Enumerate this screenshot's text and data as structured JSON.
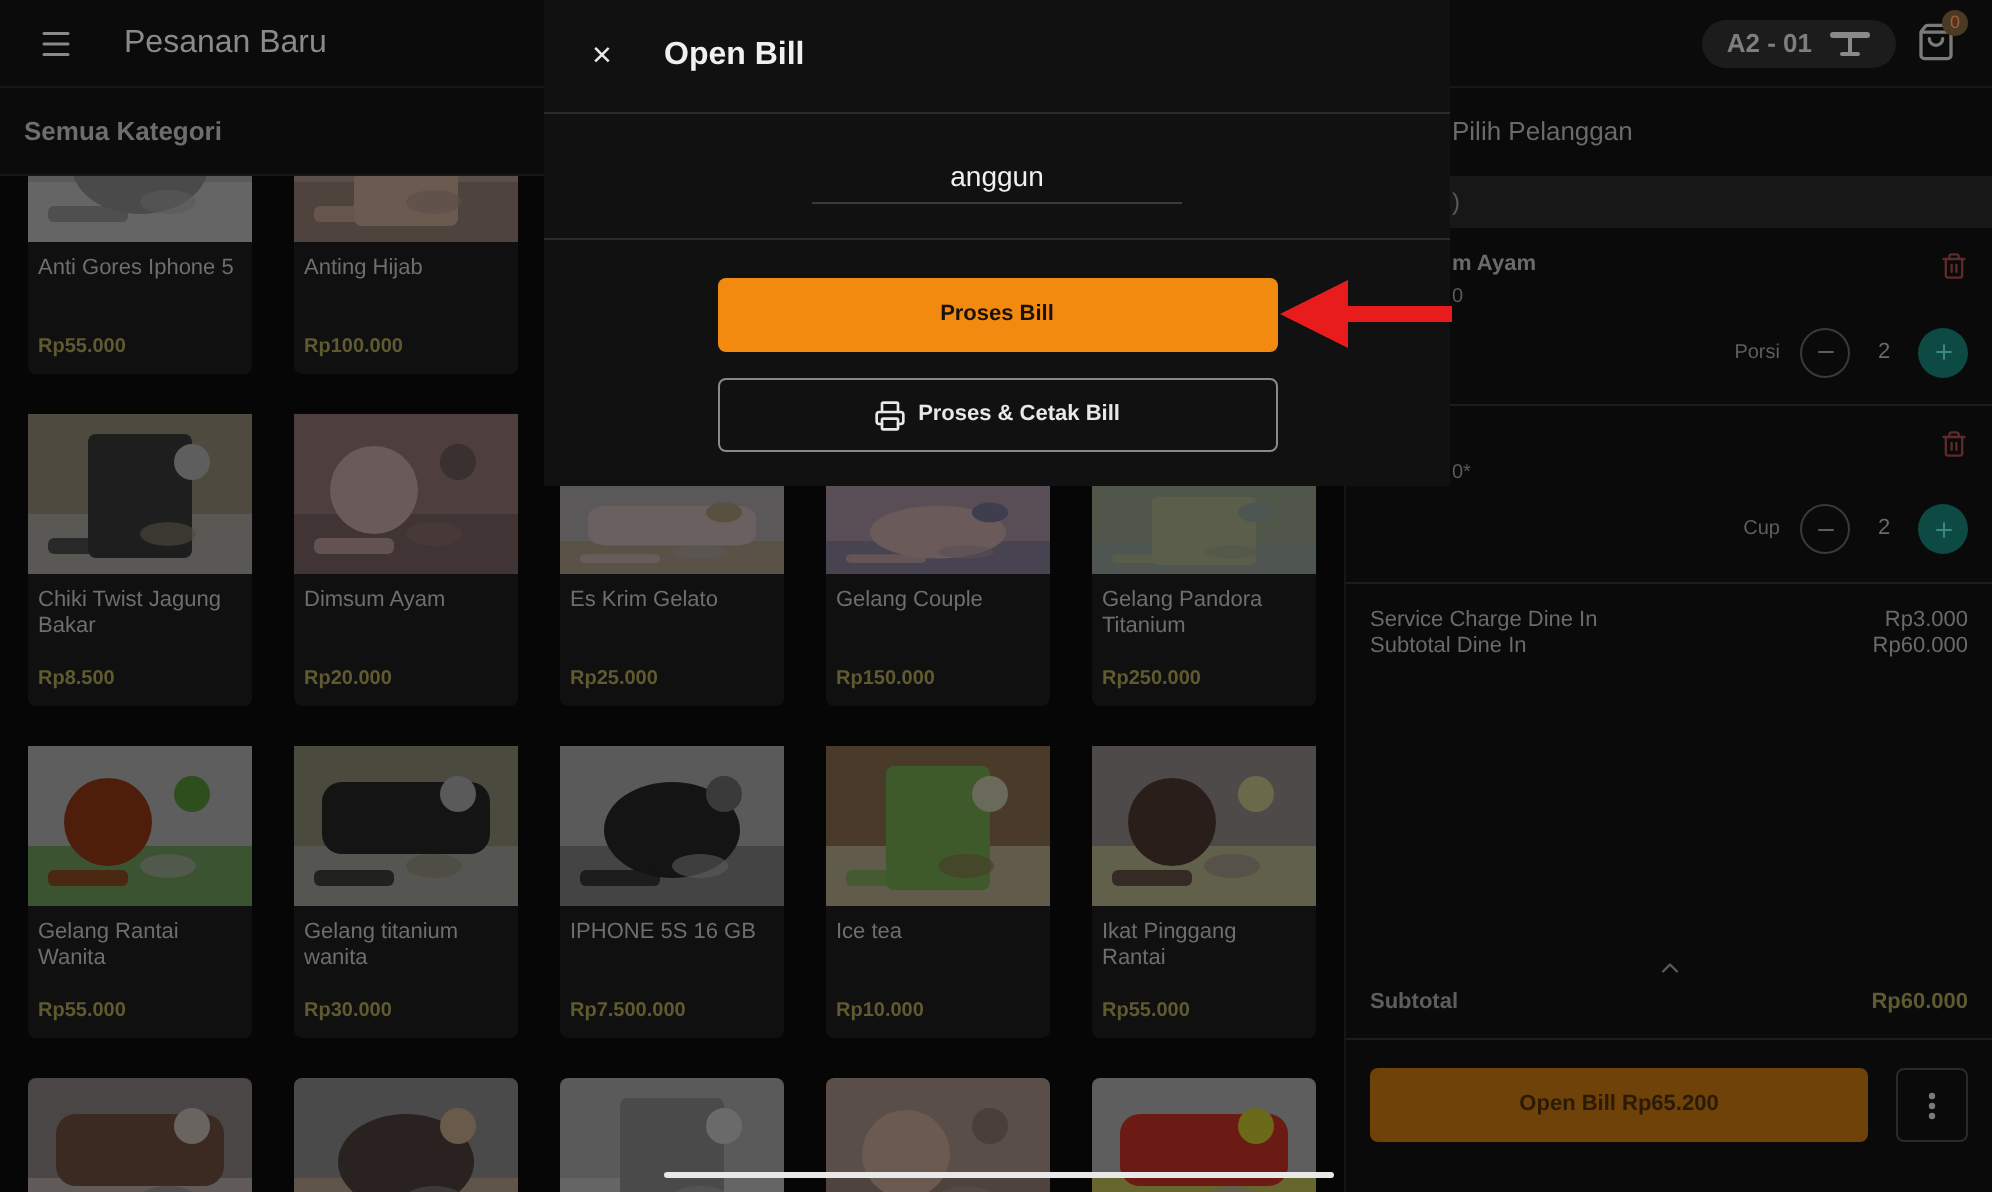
{
  "header": {
    "title": "Pesanan Baru",
    "table": "A2 - 01",
    "cart_count": "0"
  },
  "categories_label": "Semua Kategori",
  "product_rows": [
    [
      {
        "name": "Anti Gores Iphone 5",
        "price": "Rp55.000"
      },
      {
        "name": "Anting Hijab",
        "price": "Rp100.000"
      }
    ],
    [
      {
        "name": "Chiki Twist Jagung Bakar",
        "price": "Rp8.500"
      },
      {
        "name": "Dimsum Ayam",
        "price": "Rp20.000"
      },
      {
        "name": "Es Krim Gelato",
        "price": "Rp25.000"
      },
      {
        "name": "Gelang Couple",
        "price": "Rp150.000"
      },
      {
        "name": "Gelang Pandora Titanium",
        "price": "Rp250.000"
      }
    ],
    [
      {
        "name": "Gelang Rantai Wanita",
        "price": "Rp55.000"
      },
      {
        "name": "Gelang titanium wanita",
        "price": "Rp30.000"
      },
      {
        "name": "IPHONE 5S 16 GB",
        "price": "Rp7.500.000"
      },
      {
        "name": "Ice tea",
        "price": "Rp10.000"
      },
      {
        "name": "Ikat Pinggang Rantai",
        "price": "Rp55.000"
      }
    ]
  ],
  "partial_row": [
    {
      "kind": "picture"
    },
    {
      "kind": "picture"
    },
    {
      "kind": "picture"
    },
    {
      "kind": "picture"
    },
    {
      "kind": "picture"
    }
  ],
  "dialog": {
    "close": "×",
    "title": "Open Bill",
    "customer": "anggun",
    "primary": "Proses Bill",
    "secondary": "Proses & Cetak Bill"
  },
  "cart": {
    "customer_label": "Pilih Pelanggan",
    "section": ")",
    "items": [
      {
        "name": "m Ayam",
        "note": "0",
        "unit": "Porsi",
        "qty": "2"
      },
      {
        "note": "0*",
        "unit": "Cup",
        "qty": "2"
      }
    ],
    "charges": [
      {
        "label": "Service Charge Dine In",
        "value": "Rp3.000"
      },
      {
        "label": "Subtotal Dine In",
        "value": "Rp60.000"
      }
    ],
    "subtotal": {
      "label": "Subtotal",
      "value": "Rp60.000"
    },
    "open_bill": "Open Bill Rp65.200"
  }
}
